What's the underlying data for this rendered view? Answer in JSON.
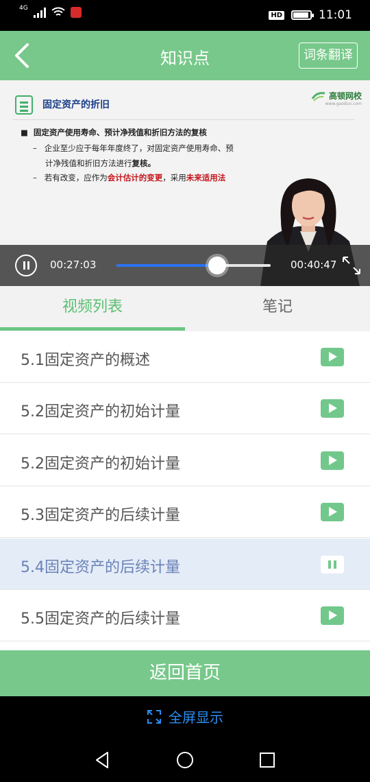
{
  "status_bar": {
    "network": "4G",
    "time": "11:01",
    "hd": "HD"
  },
  "header": {
    "title": "知识点",
    "translate_label": "词条翻译"
  },
  "video": {
    "slide_title": "固定资产的折旧",
    "brand_name": "高顿网校",
    "brand_url": "www.gaodun.com",
    "bullet": "固定资产使用寿命、预计净残值和折旧方法的复核",
    "line1": "企业至少应于每年年度终了，对固定资产使用寿命、预",
    "line2_a": "计净残值和折旧方法进行",
    "line2_b": "复核。",
    "line3_a": "若有改变，应作为",
    "line3_b": "会计估计的变更",
    "line3_c": "，采用",
    "line3_d": "未来适用法",
    "current_time": "00:27:03",
    "total_time": "00:40:47",
    "progress": 0.653
  },
  "tabs": {
    "video_list": "视频列表",
    "notes": "笔记"
  },
  "list": [
    {
      "label": "5.1固定资产的概述",
      "state": "play"
    },
    {
      "label": "5.2固定资产的初始计量",
      "state": "play"
    },
    {
      "label": "5.2固定资产的初始计量",
      "state": "play"
    },
    {
      "label": "5.3固定资产的后续计量",
      "state": "play"
    },
    {
      "label": "5.4固定资产的后续计量",
      "state": "playing"
    },
    {
      "label": "5.5固定资产的后续计量",
      "state": "play"
    }
  ],
  "bottom": {
    "home_label": "返回首页",
    "fullscreen_label": "全屏显示"
  },
  "colors": {
    "accent": "#77c88a",
    "tab_active": "#5bbf73",
    "progress": "#2a72f5",
    "link": "#2d8df0",
    "playing_bg": "#e4ecf7"
  }
}
